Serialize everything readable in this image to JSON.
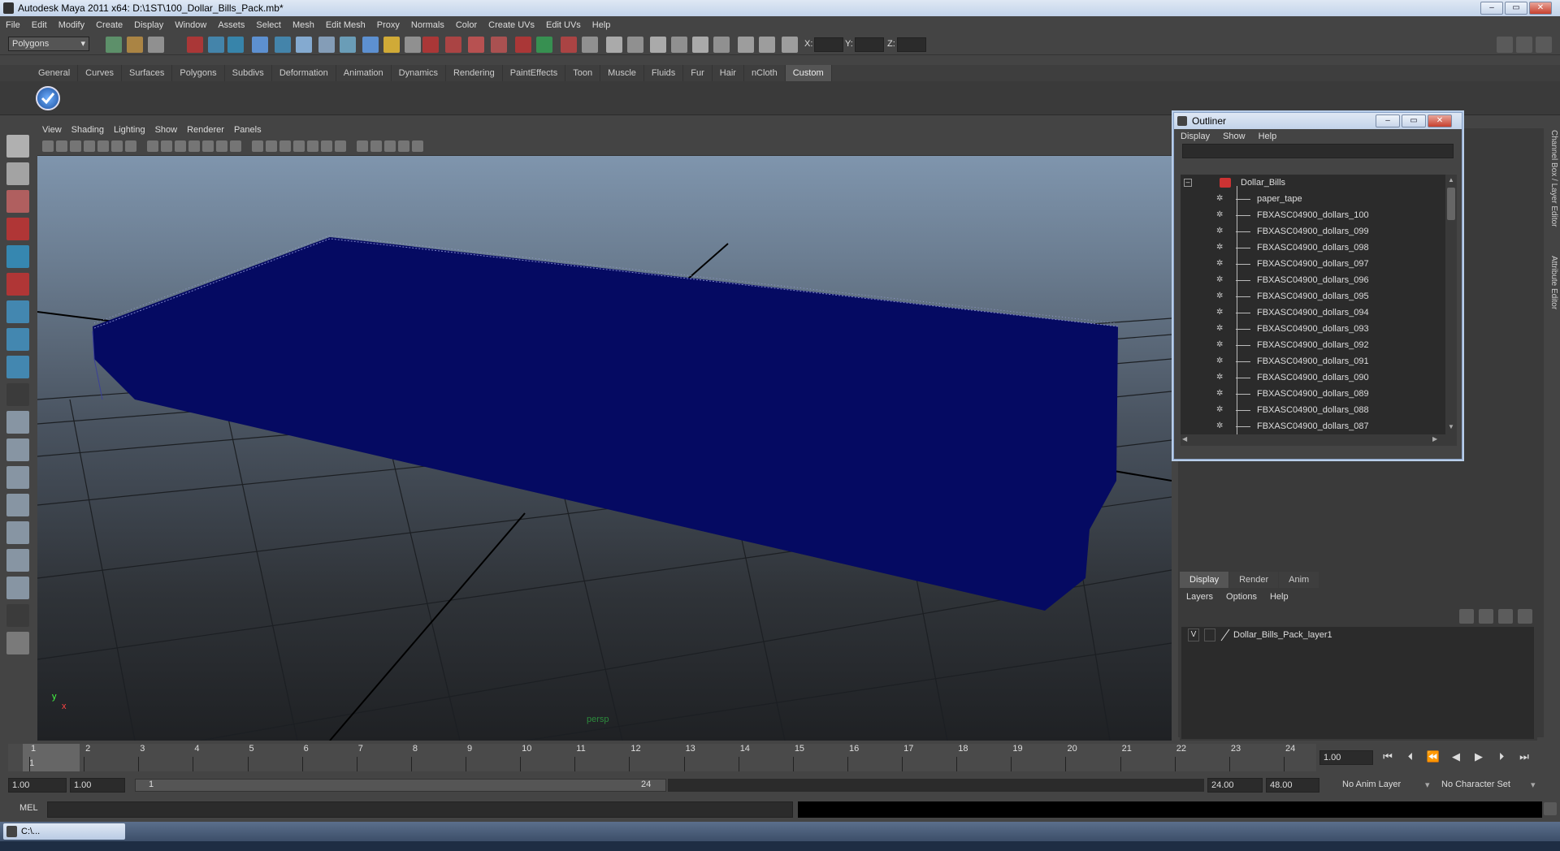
{
  "window": {
    "title": "Autodesk Maya 2011 x64: D:\\1ST\\100_Dollar_Bills_Pack.mb*"
  },
  "menu": [
    "File",
    "Edit",
    "Modify",
    "Create",
    "Display",
    "Window",
    "Assets",
    "Select",
    "Mesh",
    "Edit Mesh",
    "Proxy",
    "Normals",
    "Color",
    "Create UVs",
    "Edit UVs",
    "Help"
  ],
  "toolbar": {
    "mode": "Polygons",
    "x_label": "X:",
    "y_label": "Y:",
    "z_label": "Z:"
  },
  "shelf_tabs": [
    "General",
    "Curves",
    "Surfaces",
    "Polygons",
    "Subdivs",
    "Deformation",
    "Animation",
    "Dynamics",
    "Rendering",
    "PaintEffects",
    "Toon",
    "Muscle",
    "Fluids",
    "Fur",
    "Hair",
    "nCloth",
    "Custom"
  ],
  "shelf_active": "Custom",
  "viewport": {
    "menu": [
      "View",
      "Shading",
      "Lighting",
      "Show",
      "Renderer",
      "Panels"
    ],
    "camera_label": "persp",
    "axis_y": "y",
    "axis_x": "x"
  },
  "outliner": {
    "title": "Outliner",
    "menu": [
      "Display",
      "Show",
      "Help"
    ],
    "root": "Dollar_Bills",
    "items": [
      "paper_tape",
      "FBXASC04900_dollars_100",
      "FBXASC04900_dollars_099",
      "FBXASC04900_dollars_098",
      "FBXASC04900_dollars_097",
      "FBXASC04900_dollars_096",
      "FBXASC04900_dollars_095",
      "FBXASC04900_dollars_094",
      "FBXASC04900_dollars_093",
      "FBXASC04900_dollars_092",
      "FBXASC04900_dollars_091",
      "FBXASC04900_dollars_090",
      "FBXASC04900_dollars_089",
      "FBXASC04900_dollars_088",
      "FBXASC04900_dollars_087"
    ]
  },
  "side_tabs": {
    "channel_box": "Channel Box / Layer Editor",
    "attribute_editor": "Attribute Editor"
  },
  "layers": {
    "tabs": [
      "Display",
      "Render",
      "Anim"
    ],
    "active_tab": "Display",
    "menu": [
      "Layers",
      "Options",
      "Help"
    ],
    "layer_visibility": "V",
    "layer_name": "Dollar_Bills_Pack_layer1"
  },
  "timeline": {
    "ticks": [
      "1",
      "2",
      "3",
      "4",
      "5",
      "6",
      "7",
      "8",
      "9",
      "10",
      "11",
      "12",
      "13",
      "14",
      "15",
      "16",
      "17",
      "18",
      "19",
      "20",
      "21",
      "22",
      "23",
      "24"
    ],
    "current_frame": "1",
    "current_time_field": "1.00"
  },
  "range": {
    "start_time": "1.00",
    "playback_start": "1.00",
    "range_start": "1",
    "range_end": "24",
    "playback_end": "24.00",
    "end_time": "48.00",
    "anim_layer": "No Anim Layer",
    "character_set": "No Character Set"
  },
  "command": {
    "label": "MEL"
  },
  "taskbar": {
    "item": "C:\\..."
  }
}
